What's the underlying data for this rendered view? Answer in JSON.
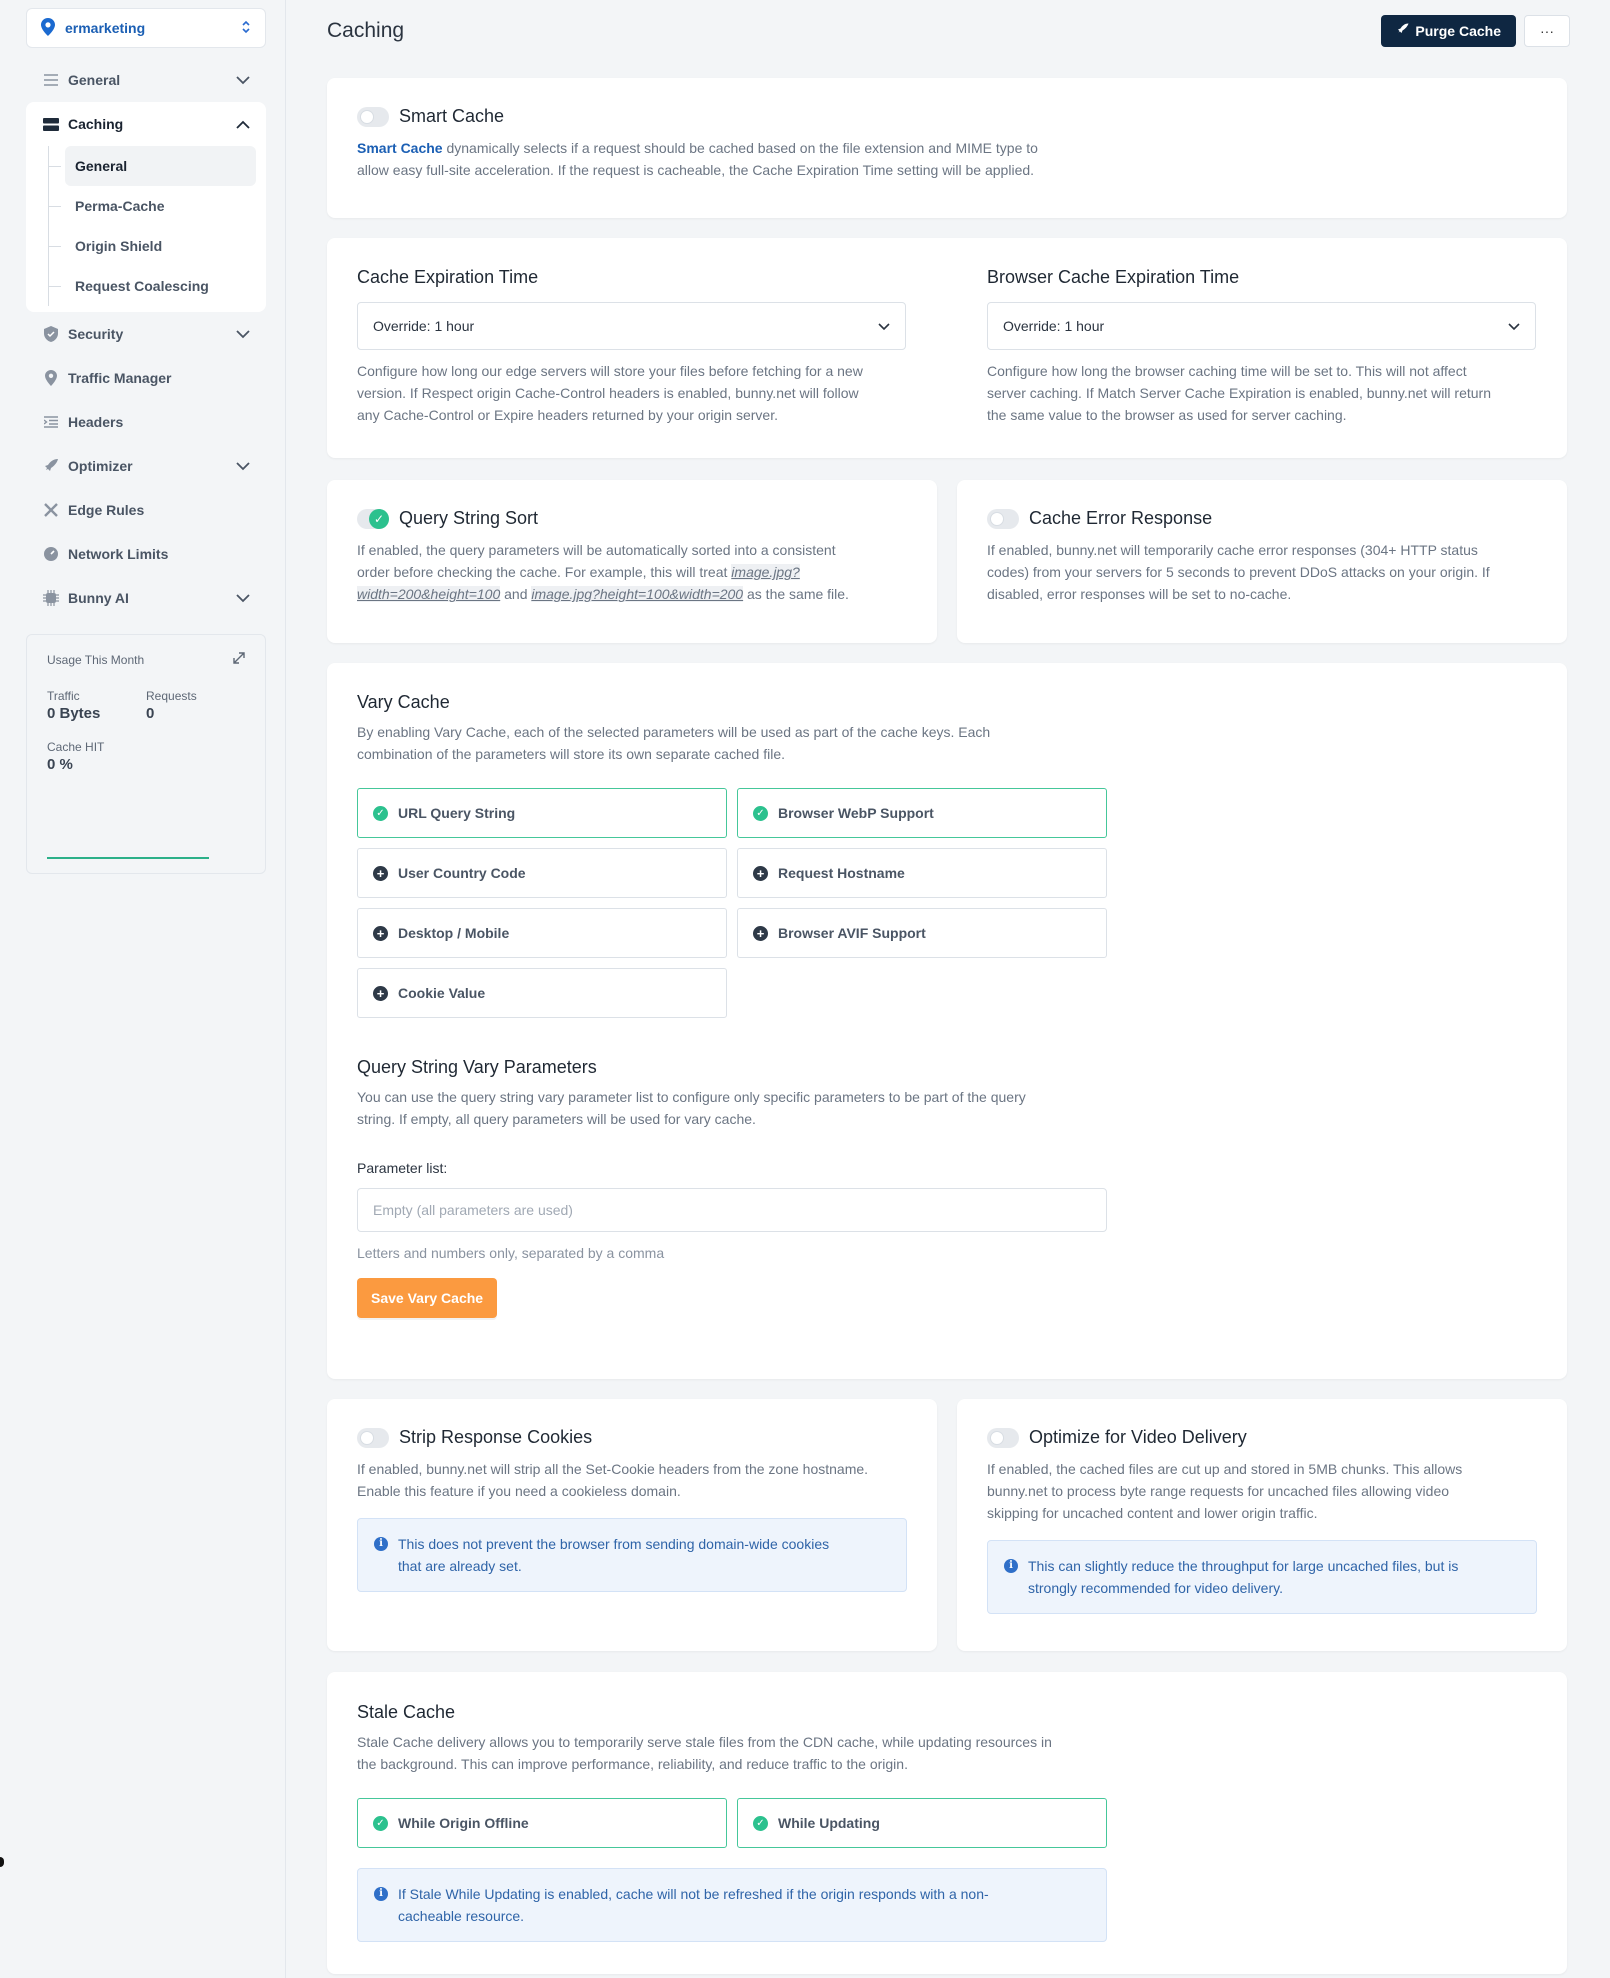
{
  "sidebar": {
    "zone": "ermarketing",
    "items": {
      "general": "General",
      "caching": "Caching",
      "security": "Security",
      "traffic_manager": "Traffic Manager",
      "headers": "Headers",
      "optimizer": "Optimizer",
      "edge_rules": "Edge Rules",
      "network_limits": "Network Limits",
      "bunny_ai": "Bunny AI"
    },
    "caching_sub": [
      "General",
      "Perma-Cache",
      "Origin Shield",
      "Request Coalescing"
    ],
    "usage": {
      "title": "Usage This Month",
      "traffic_label": "Traffic",
      "traffic_value": "0 Bytes",
      "requests_label": "Requests",
      "requests_value": "0",
      "hit_label": "Cache HIT",
      "hit_value": "0 %"
    }
  },
  "header": {
    "title": "Caching",
    "purge_label": "Purge Cache",
    "more_label": "···"
  },
  "smart_cache": {
    "title": "Smart Cache",
    "enabled": false,
    "link": "Smart Cache",
    "desc_line1": " dynamically selects if a request should be cached based on the file extension and MIME type to",
    "desc_line2": "allow easy full-site acceleration. If the request is cacheable, the Cache Expiration Time setting will be applied."
  },
  "cache_expiration": {
    "title": "Cache Expiration Time",
    "value": "Override: 1 hour",
    "desc": [
      "Configure how long our edge servers will store your files before fetching for a new",
      "version. If Respect origin Cache-Control headers is enabled, bunny.net will follow",
      "any Cache-Control or Expire headers returned by your origin server."
    ]
  },
  "browser_expiration": {
    "title": "Browser Cache Expiration Time",
    "value": "Override: 1 hour",
    "desc": [
      "Configure how long the browser caching time will be set to. This will not affect",
      "server caching. If Match Server Cache Expiration is enabled, bunny.net will return",
      "the same value to the browser as used for server caching."
    ]
  },
  "query_sort": {
    "title": "Query String Sort",
    "enabled": true,
    "desc_line1": "If enabled, the query parameters will be automatically sorted into a consistent",
    "desc_line2a": "order before checking the cache. For example, this will treat ",
    "code1a": "image.jpg?",
    "code1b": "width=200&height=100",
    "and": " and ",
    "code2": "image.jpg?height=100&width=200",
    "desc_end": " as the same file."
  },
  "error_response": {
    "title": "Cache Error Response",
    "enabled": false,
    "desc": [
      "If enabled, bunny.net will temporarily cache error responses (304+ HTTP status",
      "codes) from your servers for 5 seconds to prevent DDoS attacks on your origin. If",
      "disabled, error responses will be set to no-cache."
    ]
  },
  "vary_cache": {
    "title": "Vary Cache",
    "desc": [
      "By enabling Vary Cache, each of the selected parameters will be used as part of the cache keys. Each",
      "combination of the parameters will store its own separate cached file."
    ],
    "options": [
      {
        "label": "URL Query String",
        "selected": true
      },
      {
        "label": "Browser WebP Support",
        "selected": true
      },
      {
        "label": "User Country Code",
        "selected": false
      },
      {
        "label": "Request Hostname",
        "selected": false
      },
      {
        "label": "Desktop / Mobile",
        "selected": false
      },
      {
        "label": "Browser AVIF Support",
        "selected": false
      },
      {
        "label": "Cookie Value",
        "selected": false
      }
    ],
    "qs_title": "Query String Vary Parameters",
    "qs_desc": [
      "You can use the query string vary parameter list to configure only specific parameters to be part of the query",
      "string. If empty, all query parameters will be used for vary cache."
    ],
    "param_label": "Parameter list:",
    "param_placeholder": "Empty (all parameters are used)",
    "param_hint": "Letters and numbers only, separated by a comma",
    "save_label": "Save Vary Cache"
  },
  "strip_cookies": {
    "title": "Strip Response Cookies",
    "enabled": false,
    "desc": [
      "If enabled, bunny.net will strip all the Set-Cookie headers from the zone hostname.",
      "Enable this feature if you need a cookieless domain."
    ],
    "info": [
      "This does not prevent the browser from sending domain-wide cookies",
      "that are already set."
    ]
  },
  "video_delivery": {
    "title": "Optimize for Video Delivery",
    "enabled": false,
    "desc": [
      "If enabled, the cached files are cut up and stored in 5MB chunks. This allows",
      "bunny.net to process byte range requests for uncached files allowing video",
      "skipping for uncached content and lower origin traffic."
    ],
    "info": [
      "This can slightly reduce the throughput for large uncached files, but is",
      "strongly recommended for video delivery."
    ]
  },
  "stale_cache": {
    "title": "Stale Cache",
    "desc": [
      "Stale Cache delivery allows you to temporarily serve stale files from the CDN cache, while updating resources in",
      "the background. This can improve performance, reliability, and reduce traffic to the origin."
    ],
    "options": [
      {
        "label": "While Origin Offline",
        "selected": true
      },
      {
        "label": "While Updating",
        "selected": true
      }
    ],
    "info": [
      "If Stale While Updating is enabled, cache will not be refreshed if the origin responds with a non-",
      "cacheable resource."
    ]
  },
  "colors": {
    "accent": "#1b5fb4",
    "success": "#2cc18e",
    "primary_dark": "#0f2742",
    "save": "#fb9a40"
  }
}
